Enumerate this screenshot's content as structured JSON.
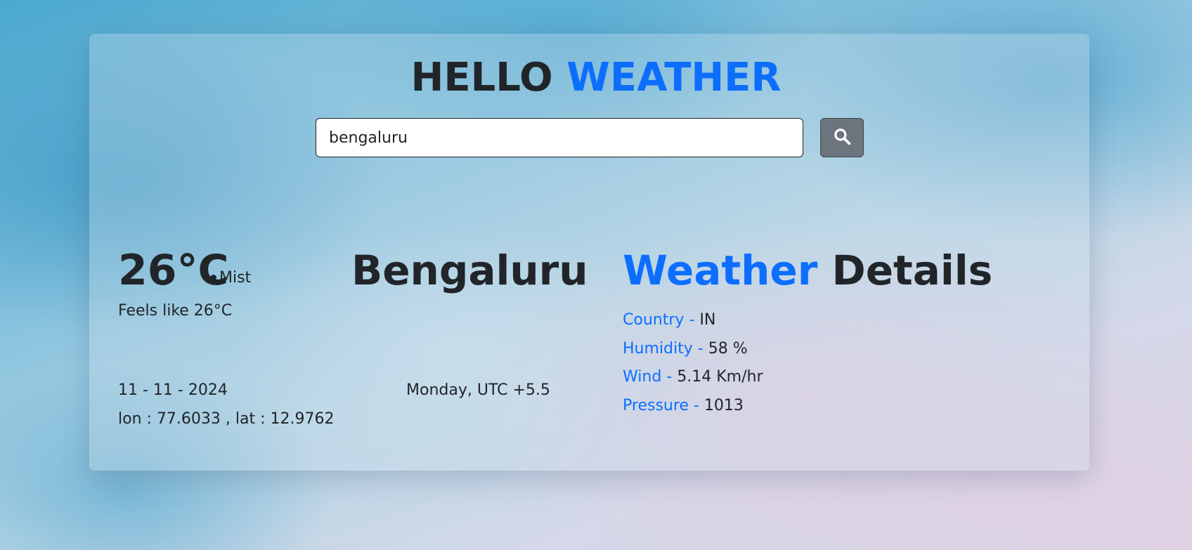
{
  "header": {
    "title_part1": "HELLO",
    "title_part2": "WEATHER"
  },
  "search": {
    "value": "bengaluru",
    "button_icon": "search-icon"
  },
  "current": {
    "temperature": "26°C",
    "separator": "•",
    "condition": "Mist",
    "feels_like": "Feels like 26°C",
    "city": "Bengaluru",
    "date": "11 - 11 - 2024",
    "coordinates": "lon : 77.6033 , lat : 12.9762",
    "day_timezone": "Monday, UTC +5.5"
  },
  "details": {
    "title_part1": "Weather",
    "title_part2": "Details",
    "dash": "-",
    "items": [
      {
        "label": "Country",
        "value": "IN"
      },
      {
        "label": "Humidity",
        "value": "58 %"
      },
      {
        "label": "Wind",
        "value": "5.14 Km/hr"
      },
      {
        "label": "Pressure",
        "value": "1013"
      }
    ]
  },
  "colors": {
    "accent": "#0d6efd",
    "text": "#212529",
    "button": "#6c757d"
  }
}
